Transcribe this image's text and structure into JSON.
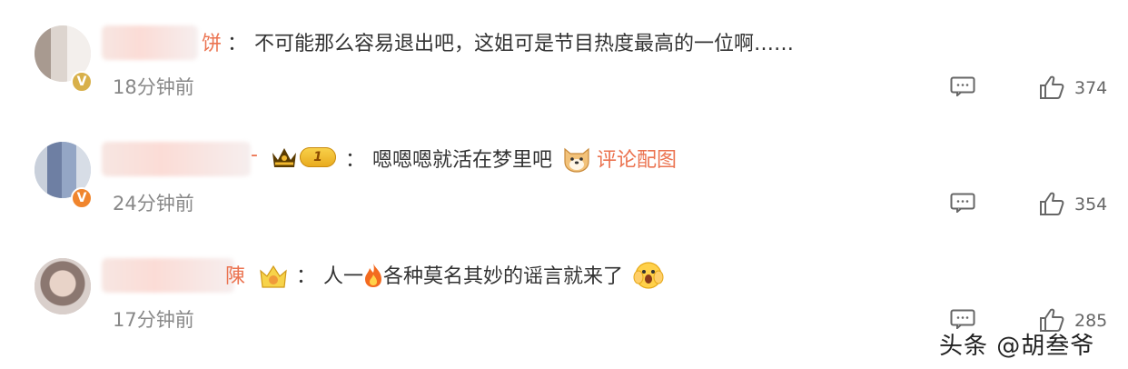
{
  "comments": [
    {
      "username_suffix": "饼",
      "colon": "：",
      "text": "不可能那么容易退出吧，这姐可是节目热度最高的一位啊……",
      "time": "18分钟前",
      "likes": "374",
      "badge": "gold-v"
    },
    {
      "username_suffix": "-",
      "colon": "：",
      "level": "1",
      "text": "嗯嗯嗯就活在梦里吧",
      "link": "评论配图",
      "time": "24分钟前",
      "likes": "354",
      "badge": "orange-v"
    },
    {
      "username_suffix": "陳",
      "colon": "：",
      "text_before_emoji": "人一",
      "text_after_emoji": "各种莫名其妙的谣言就来了",
      "time": "17分钟前",
      "likes": "285"
    }
  ],
  "icons": {
    "reply": "comment-bubble-icon",
    "like": "thumbs-up-icon",
    "dog_emoji": "doge-emoji-icon",
    "fire_emoji": "fire-emoji-icon",
    "face_emoji": "hands-face-emoji-icon",
    "crown": "crown-icon"
  },
  "colors": {
    "accent": "#eb7350",
    "time": "#888888",
    "text": "#333333"
  },
  "watermark": "头条 @胡叁爷"
}
